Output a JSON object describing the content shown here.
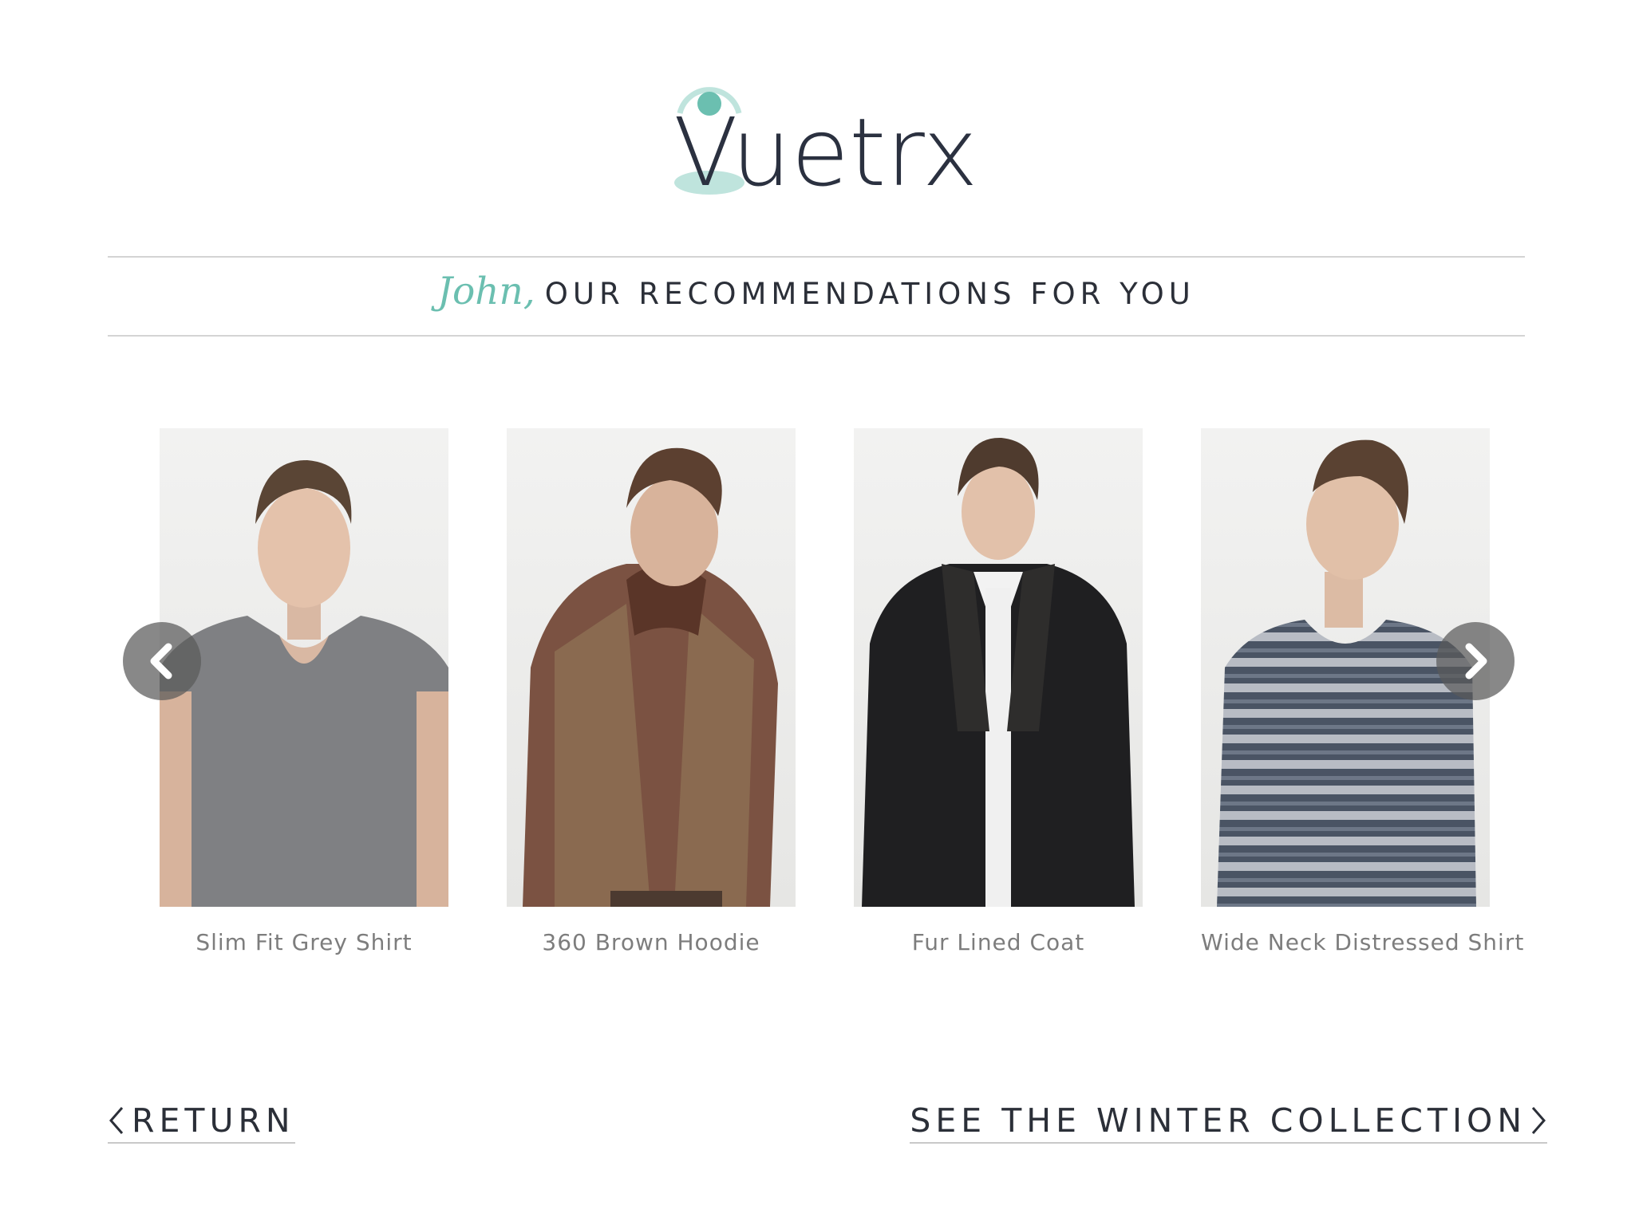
{
  "brand": {
    "name": "Vuetrx",
    "accent_color": "#6bbfb0",
    "text_color": "#2b3140"
  },
  "heading": {
    "name": "John,",
    "text": "OUR RECOMMENDATIONS FOR YOU"
  },
  "products": [
    {
      "name": "Slim Fit Grey Shirt",
      "image": "man-grey-vneck-tshirt"
    },
    {
      "name": "360 Brown Hoodie",
      "image": "man-brown-hoodie-vest"
    },
    {
      "name": "Fur Lined Coat",
      "image": "man-black-coat"
    },
    {
      "name": "Wide Neck Distressed Shirt",
      "image": "man-striped-shirt"
    }
  ],
  "carousel": {
    "prev_icon": "chevron-left-icon",
    "next_icon": "chevron-right-icon"
  },
  "footer": {
    "return_label": "RETURN",
    "collection_label": "SEE THE WINTER COLLECTION"
  }
}
